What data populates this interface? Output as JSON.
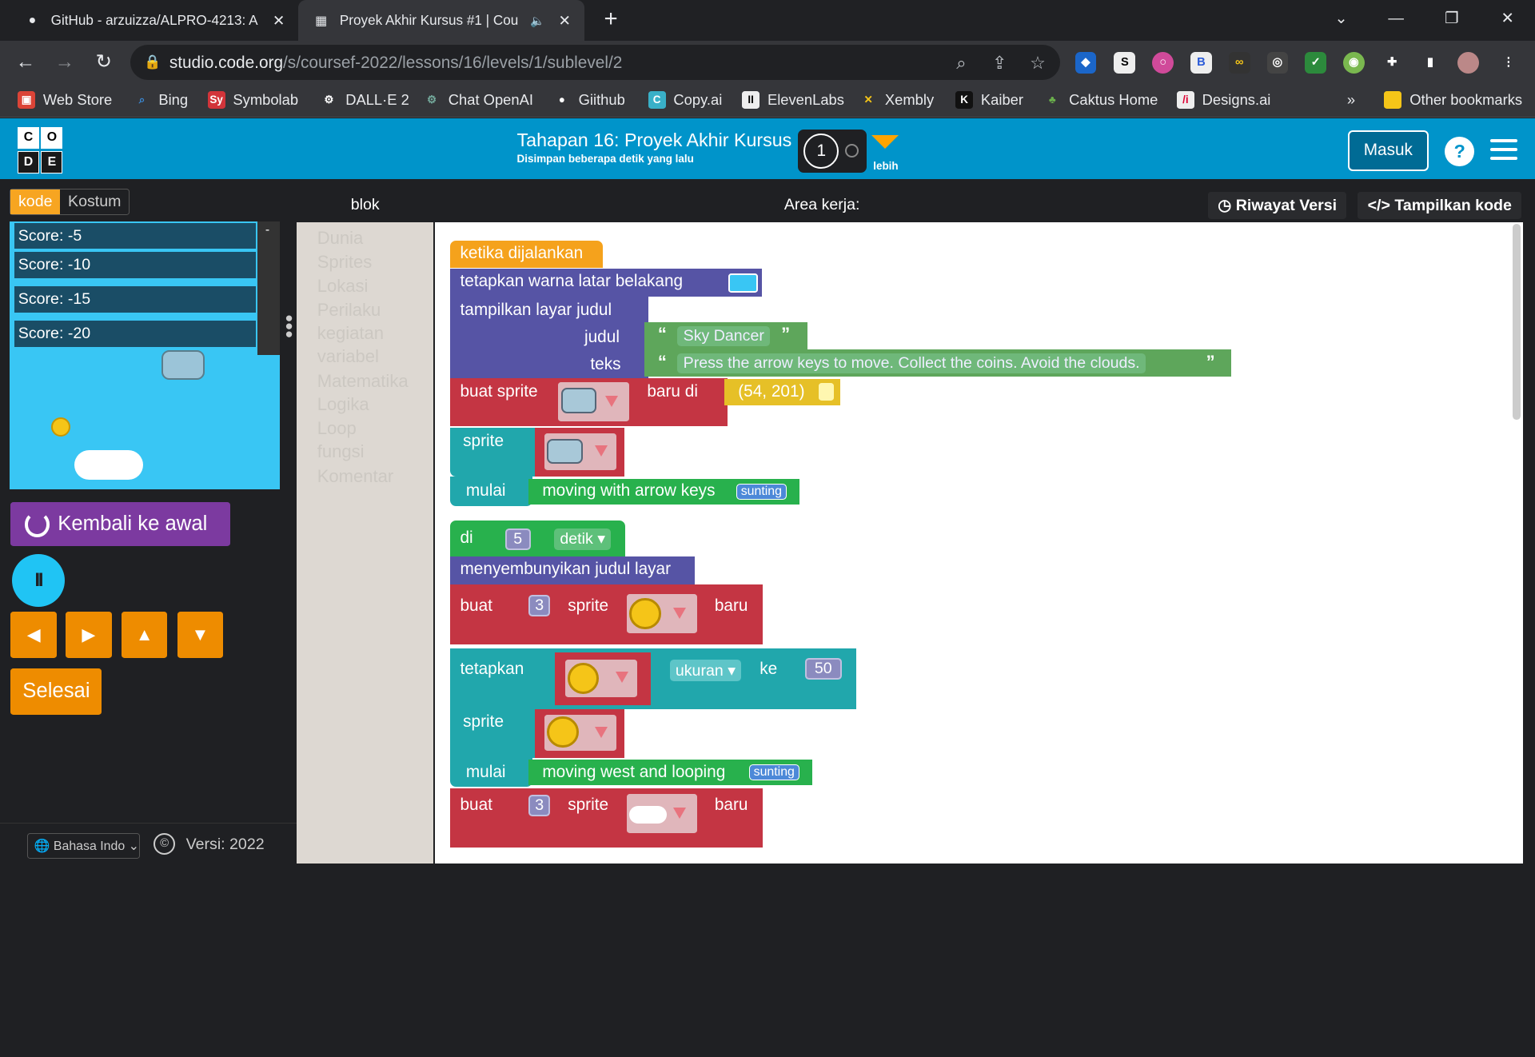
{
  "browser": {
    "tabs": [
      {
        "title": "GitHub - arzuizza/ALPRO-4213: A",
        "active": false
      },
      {
        "title": "Proyek Akhir Kursus #1 | Cou",
        "active": true
      }
    ],
    "url_host": "studio.code.org",
    "url_path": "/s/coursef-2022/lessons/16/levels/1/sublevel/2",
    "bookmarks": [
      "Web Store",
      "Bing",
      "Symbolab",
      "DALL·E 2",
      "Chat OpenAI",
      "Giithub",
      "Copy.ai",
      "ElevenLabs",
      "Xembly",
      "Kaiber",
      "Caktus Home",
      "Designs.ai"
    ],
    "other_bookmarks": "Other bookmarks",
    "overflow": "»"
  },
  "header": {
    "logo": [
      "C",
      "O",
      "D",
      "E"
    ],
    "title": "Tahapan 16: Proyek Akhir Kursus",
    "subtitle": "Disimpan beberapa detik yang lalu",
    "progress_level": "1",
    "more_label": "lebih",
    "signin_label": "Masuk",
    "help_label": "?"
  },
  "left": {
    "tabs": [
      "kode",
      "Kostum"
    ],
    "scores": [
      "Score: -5",
      "Score: -10",
      "Score: -15",
      "Score: -20"
    ],
    "reset_label": "Kembali ke awal",
    "pause_label": "II",
    "arrows": [
      "◀",
      "▶",
      "▲",
      "▼"
    ],
    "done_label": "Selesai",
    "language": "Bahasa Indo",
    "copyright": "©",
    "version": "Versi: 2022"
  },
  "palette": {
    "header": "blok",
    "categories": [
      "Dunia",
      "Sprites",
      "Lokasi",
      "Perilaku",
      "kegiatan",
      "variabel",
      "Matematika",
      "Logika",
      "Loop",
      "fungsi",
      "Komentar"
    ]
  },
  "workspace": {
    "title": "Area kerja:",
    "history_label": "Riwayat Versi",
    "show_code_label": "Tampilkan kode",
    "blocks": {
      "when_run": "ketika dijalankan",
      "set_bg": "tetapkan warna latar belakang",
      "show_title": "tampilkan layar judul",
      "judul": "judul",
      "teks": "teks",
      "title_value": "Sky Dancer",
      "text_value": "Press the arrow keys to move. Collect the coins. Avoid the clouds.",
      "make_sprite": "buat sprite",
      "new_at": "baru di",
      "location": "(54, 201)",
      "sprite": "sprite",
      "start": "mulai",
      "behavior1": "moving with arrow keys",
      "edit": "sunting",
      "at": "di",
      "seconds_value": "5",
      "seconds": "detik",
      "hide_title": "menyembunyikan judul layar",
      "make": "buat",
      "count1": "3",
      "new": "baru",
      "set": "tetapkan",
      "size": "ukuran",
      "to": "ke",
      "size_value": "50",
      "behavior2": "moving west and looping",
      "count2": "3"
    }
  },
  "colors": {
    "header_bg": "#0094ca",
    "stage_bg": "#39c6f4",
    "reset_bg": "#7c3aa0",
    "arrow_bg": "#ee8c00"
  }
}
